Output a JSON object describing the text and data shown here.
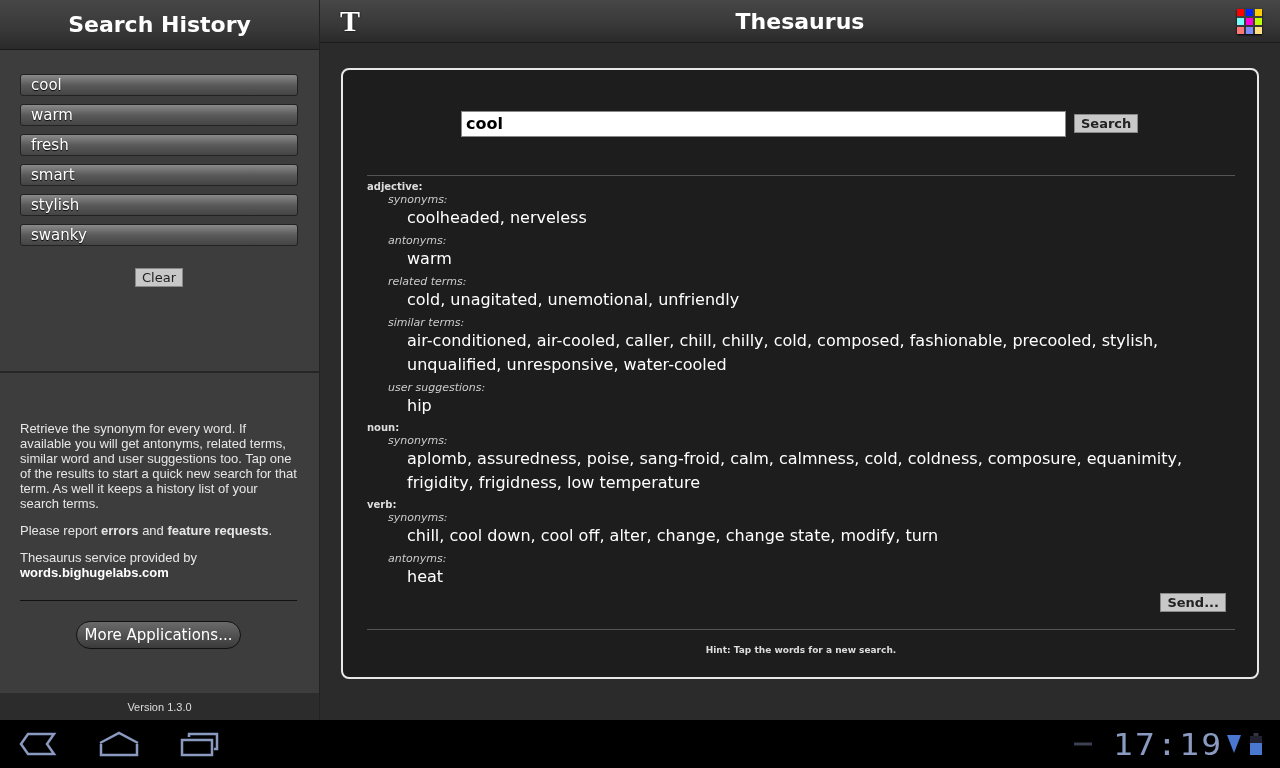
{
  "sidebar": {
    "title": "Search History",
    "history": [
      {
        "label": "cool"
      },
      {
        "label": "warm"
      },
      {
        "label": "fresh"
      },
      {
        "label": "smart"
      },
      {
        "label": "stylish"
      },
      {
        "label": "swanky"
      }
    ],
    "clear_button": "Clear",
    "description": "Retrieve the synonym for every word. If available you will get antonyms, related terms, similar word and user suggestions too. Tap one of the results to start a quick new search for that term. As well it keeps a history list of your search terms.",
    "report": "Please report **errors** and **feature requests**.",
    "credit": "Thesaurus service provided by",
    "credit_link": "words.bighugelabs.com",
    "more_button": "More Applications...",
    "version": "Version 1.3.0"
  },
  "header": {
    "logo": "T",
    "title": "Thesaurus",
    "color_grid": [
      {
        "color": "#ff0000"
      },
      {
        "color": "#0022ff"
      },
      {
        "color": "#ffcc00"
      },
      {
        "color": "#77ffff"
      },
      {
        "color": "#ff00dd"
      },
      {
        "color": "#bbff00"
      },
      {
        "color": "#ff7777"
      },
      {
        "color": "#7f8cff"
      },
      {
        "color": "#ffe080"
      }
    ]
  },
  "search": {
    "value": "cool",
    "button": "Search"
  },
  "results": [
    {
      "part": "adjective:",
      "groups": [
        {
          "label": "synonyms:",
          "terms": "coolheaded, nerveless"
        },
        {
          "label": "antonyms:",
          "terms": "warm"
        },
        {
          "label": "related terms:",
          "terms": "cold, unagitated, unemotional, unfriendly"
        },
        {
          "label": "similar terms:",
          "terms": "air-conditioned, air-cooled, caller, chill, chilly, cold, composed, fashionable, precooled, stylish, unqualified, unresponsive, water-cooled"
        },
        {
          "label": "user suggestions:",
          "terms": "hip"
        }
      ]
    },
    {
      "part": "noun:",
      "groups": [
        {
          "label": "synonyms:",
          "terms": "aplomb, assuredness, poise, sang-froid, calm, calmness, cold, coldness, composure, equanimity, frigidity, frigidness, low temperature"
        }
      ]
    },
    {
      "part": "verb:",
      "groups": [
        {
          "label": "synonyms:",
          "terms": "chill, cool down, cool off, alter, change, change state, modify, turn"
        },
        {
          "label": "antonyms:",
          "terms": "heat"
        }
      ]
    }
  ],
  "send_button": "Send...",
  "hint": "Hint: Tap the words for a new search.",
  "status_bar": {
    "time": "17:19"
  }
}
